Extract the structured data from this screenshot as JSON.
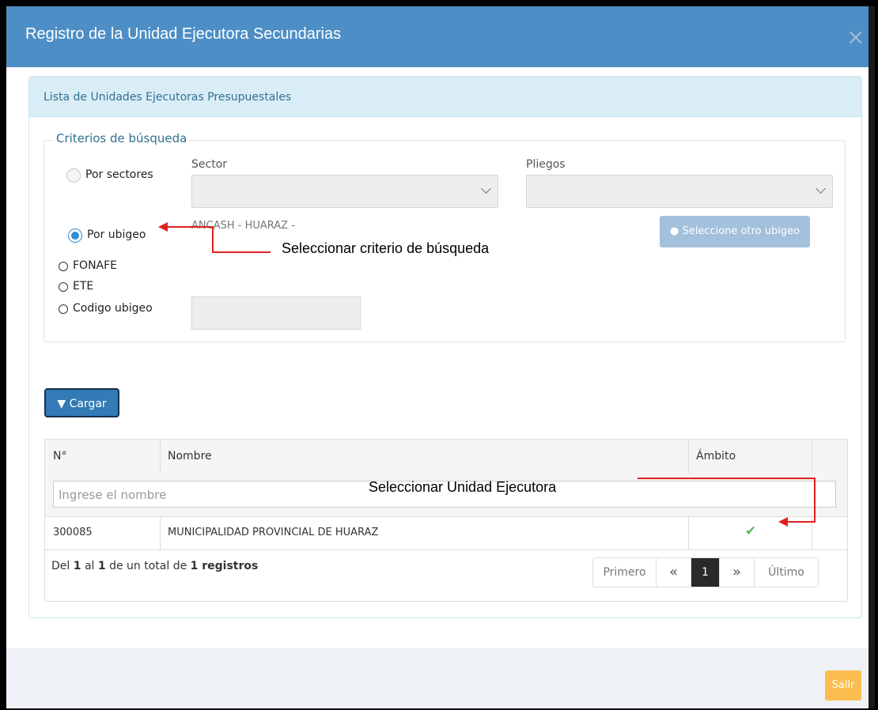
{
  "modal": {
    "title": "Registro de la Unidad Ejecutora Secundarias",
    "close_icon": "×"
  },
  "panel": {
    "heading": "Lista de Unidades Ejecutoras Presupuestales"
  },
  "criteria": {
    "legend": "Criterios de búsqueda",
    "options": {
      "por_sectores": "Por sectores",
      "por_ubigeo": "Por ubigeo",
      "fonafe": "FONAFE",
      "ete": "ETE",
      "codigo_ubigeo": "Codigo ubigeo"
    },
    "selected": "por_ubigeo",
    "sector_label": "Sector",
    "pliegos_label": "Pliegos",
    "ubigeo_value": "ANCASH - HUARAZ -",
    "ubigeo_button": "Seleccione otro ubigeo"
  },
  "load_button": "Cargar",
  "table": {
    "columns": [
      "N°",
      "Nombre",
      "Ámbito"
    ],
    "filter_placeholder": "Ingrese el nombre",
    "rows": [
      {
        "numero": "300085",
        "nombre": "MUNICIPALIDAD PROVINCIAL DE HUARAZ",
        "ambito": "check"
      }
    ],
    "info": {
      "prefix": "Del",
      "from": "1",
      "mid": "al",
      "to": "1",
      "mid2": "de un total de",
      "total": "1 registros"
    },
    "pager": {
      "first": "Primero",
      "prev_icon": "«",
      "page": "1",
      "next_icon": "»",
      "last": "Último"
    }
  },
  "footer": {
    "exit_button": "Salir"
  },
  "annotations": {
    "criteria": "Seleccionar criterio de búsqueda",
    "unit": "Seleccionar Unidad Ejecutora"
  },
  "colors": {
    "header": "#4e8ec6",
    "primary": "#337ab7",
    "warning": "#fbbd4e",
    "annotation_arrow": "#e02020"
  }
}
